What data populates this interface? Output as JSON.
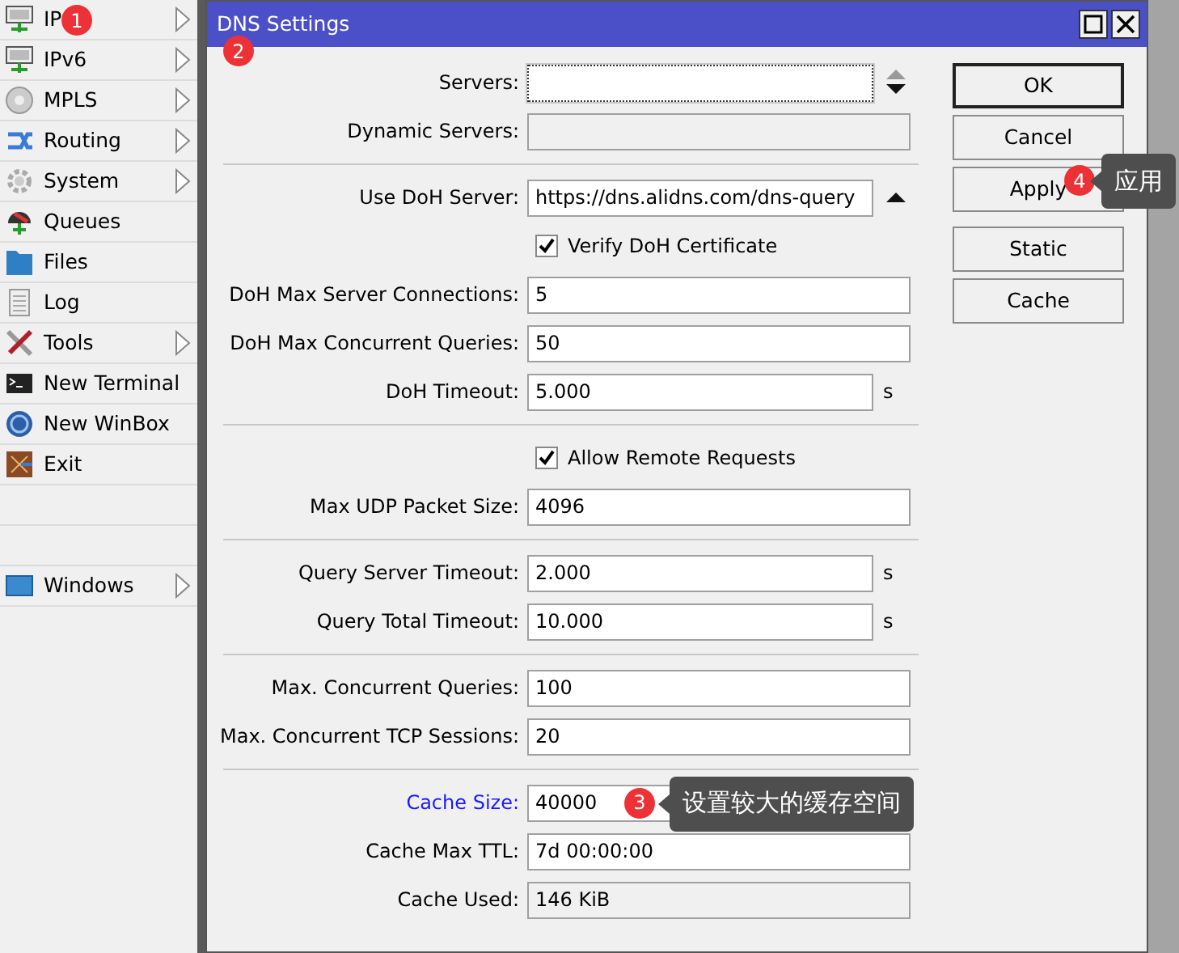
{
  "sidebar": {
    "items": [
      {
        "label": "IP",
        "has_submenu": true,
        "annotation": {
          "number": "1"
        }
      },
      {
        "label": "IPv6",
        "has_submenu": true
      },
      {
        "label": "MPLS",
        "has_submenu": true
      },
      {
        "label": "Routing",
        "has_submenu": true
      },
      {
        "label": "System",
        "has_submenu": true
      },
      {
        "label": "Queues",
        "has_submenu": false
      },
      {
        "label": "Files",
        "has_submenu": false
      },
      {
        "label": "Log",
        "has_submenu": false
      },
      {
        "label": "Tools",
        "has_submenu": true
      },
      {
        "label": "New Terminal",
        "has_submenu": false
      },
      {
        "label": "New WinBox",
        "has_submenu": false
      },
      {
        "label": "Exit",
        "has_submenu": false
      }
    ],
    "bottom_items": [
      {
        "label": "Windows",
        "has_submenu": true
      }
    ]
  },
  "window": {
    "title": "DNS Settings",
    "annotation": {
      "number": "2"
    }
  },
  "form": {
    "groups": [
      {
        "rows": [
          {
            "kind": "field",
            "label": "Servers:",
            "value": "",
            "focused": true,
            "disabled": false,
            "has_up_arrow": true,
            "up_arrow_disabled": true,
            "has_down_arrow": true
          },
          {
            "kind": "field",
            "label": "Dynamic Servers:",
            "value": "",
            "focused": false,
            "disabled": true
          }
        ]
      },
      {
        "rows": [
          {
            "kind": "field",
            "label": "Use DoH Server:",
            "value": "https://dns.alidns.com/dns-query",
            "focused": false,
            "disabled": false,
            "has_up_arrow": true,
            "up_arrow_disabled": false,
            "has_down_arrow": false
          },
          {
            "kind": "checkbox",
            "label": "Verify DoH Certificate",
            "checked": true
          },
          {
            "kind": "field",
            "label": "DoH Max Server Connections:",
            "value": "5",
            "focused": false,
            "disabled": false
          },
          {
            "kind": "field",
            "label": "DoH Max Concurrent Queries:",
            "value": "50",
            "focused": false,
            "disabled": false
          },
          {
            "kind": "field",
            "label": "DoH Timeout:",
            "value": "5.000",
            "focused": false,
            "disabled": false,
            "unit": "s"
          }
        ]
      },
      {
        "rows": [
          {
            "kind": "checkbox",
            "label": "Allow Remote Requests",
            "checked": true
          },
          {
            "kind": "field",
            "label": "Max UDP Packet Size:",
            "value": "4096",
            "focused": false,
            "disabled": false
          }
        ]
      },
      {
        "rows": [
          {
            "kind": "field",
            "label": "Query Server Timeout:",
            "value": "2.000",
            "focused": false,
            "disabled": false,
            "unit": "s"
          },
          {
            "kind": "field",
            "label": "Query Total Timeout:",
            "value": "10.000",
            "focused": false,
            "disabled": false,
            "unit": "s"
          }
        ]
      },
      {
        "rows": [
          {
            "kind": "field",
            "label": "Max. Concurrent Queries:",
            "value": "100",
            "focused": false,
            "disabled": false
          },
          {
            "kind": "field",
            "label": "Max. Concurrent TCP Sessions:",
            "value": "20",
            "focused": false,
            "disabled": false
          }
        ]
      },
      {
        "rows": [
          {
            "kind": "field",
            "label": "Cache Size:",
            "value": "40000",
            "focused": false,
            "disabled": false,
            "highlighted": true,
            "annotation": {
              "number": "3",
              "note": "设置较大的缓存空间"
            }
          },
          {
            "kind": "field",
            "label": "Cache Max TTL:",
            "value": "7d 00:00:00",
            "focused": false,
            "disabled": false
          },
          {
            "kind": "field",
            "label": "Cache Used:",
            "value": "146 KiB",
            "focused": false,
            "disabled": true
          }
        ]
      }
    ]
  },
  "button_groups": [
    {
      "buttons": [
        {
          "label": "OK",
          "default": true
        },
        {
          "label": "Cancel",
          "default": false
        },
        {
          "label": "Apply",
          "default": false,
          "annotation": {
            "number": "4",
            "note": "应用"
          }
        }
      ]
    },
    {
      "buttons": [
        {
          "label": "Static",
          "default": false
        },
        {
          "label": "Cache",
          "default": false
        }
      ]
    }
  ]
}
